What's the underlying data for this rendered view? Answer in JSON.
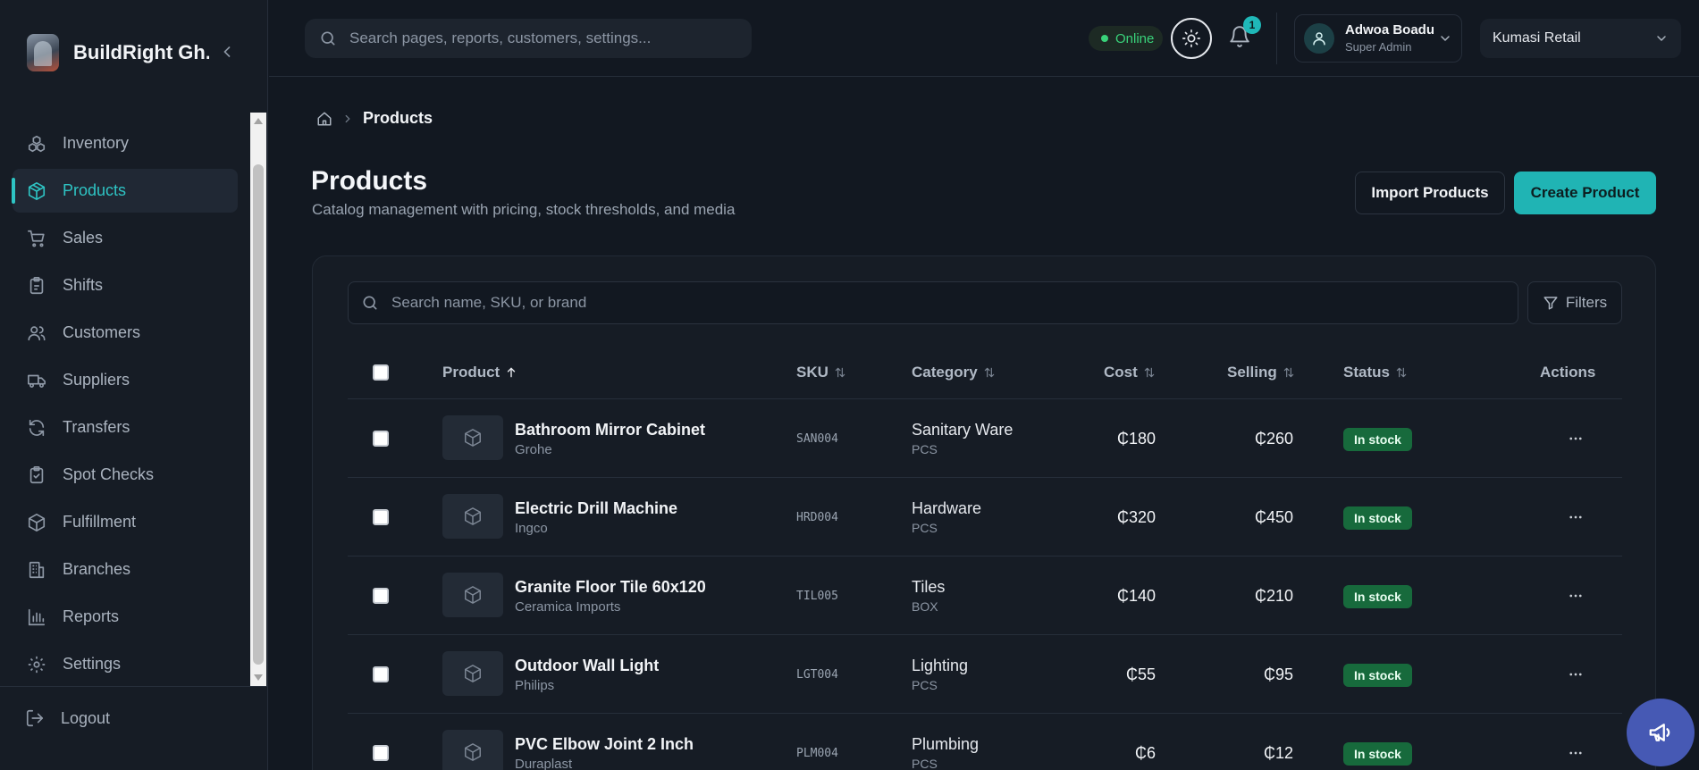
{
  "brand": {
    "name": "BuildRight Gh..."
  },
  "sidebar": {
    "items": [
      {
        "label": "Inventory",
        "icon": "boxes-icon",
        "active": false
      },
      {
        "label": "Products",
        "icon": "package-icon",
        "active": true
      },
      {
        "label": "Sales",
        "icon": "cart-icon",
        "active": false
      },
      {
        "label": "Shifts",
        "icon": "clipboard-icon",
        "active": false
      },
      {
        "label": "Customers",
        "icon": "users-icon",
        "active": false
      },
      {
        "label": "Suppliers",
        "icon": "truck-icon",
        "active": false
      },
      {
        "label": "Transfers",
        "icon": "refresh-icon",
        "active": false
      },
      {
        "label": "Spot Checks",
        "icon": "clipboard-check-icon",
        "active": false
      },
      {
        "label": "Fulfillment",
        "icon": "package-check-icon",
        "active": false
      },
      {
        "label": "Branches",
        "icon": "building-icon",
        "active": false
      },
      {
        "label": "Reports",
        "icon": "bar-chart-icon",
        "active": false
      },
      {
        "label": "Settings",
        "icon": "gear-icon",
        "active": false
      }
    ],
    "logout_label": "Logout"
  },
  "topbar": {
    "search_placeholder": "Search pages, reports, customers, settings...",
    "status_label": "Online",
    "notification_count": "1",
    "user": {
      "name": "Adwoa Boadu",
      "role": "Super Admin"
    },
    "branch": "Kumasi Retail"
  },
  "breadcrumb": {
    "current": "Products"
  },
  "page": {
    "title": "Products",
    "subtitle": "Catalog management with pricing, stock thresholds, and media",
    "import_label": "Import Products",
    "create_label": "Create Product"
  },
  "table": {
    "search_placeholder": "Search name, SKU, or brand",
    "filters_label": "Filters",
    "columns": {
      "product": "Product",
      "sku": "SKU",
      "category": "Category",
      "cost": "Cost",
      "selling": "Selling",
      "status": "Status",
      "actions": "Actions"
    },
    "rows": [
      {
        "name": "Bathroom Mirror Cabinet",
        "brand": "Grohe",
        "sku": "SAN004",
        "category": "Sanitary Ware",
        "unit": "PCS",
        "cost": "₵180",
        "selling": "₵260",
        "status": "In stock"
      },
      {
        "name": "Electric Drill Machine",
        "brand": "Ingco",
        "sku": "HRD004",
        "category": "Hardware",
        "unit": "PCS",
        "cost": "₵320",
        "selling": "₵450",
        "status": "In stock"
      },
      {
        "name": "Granite Floor Tile 60x120",
        "brand": "Ceramica Imports",
        "sku": "TIL005",
        "category": "Tiles",
        "unit": "BOX",
        "cost": "₵140",
        "selling": "₵210",
        "status": "In stock"
      },
      {
        "name": "Outdoor Wall Light",
        "brand": "Philips",
        "sku": "LGT004",
        "category": "Lighting",
        "unit": "PCS",
        "cost": "₵55",
        "selling": "₵95",
        "status": "In stock"
      },
      {
        "name": "PVC Elbow Joint 2 Inch",
        "brand": "Duraplast",
        "sku": "PLM004",
        "category": "Plumbing",
        "unit": "PCS",
        "cost": "₵6",
        "selling": "₵12",
        "status": "In stock"
      }
    ]
  },
  "colors": {
    "accent": "#20b4b4",
    "status_green": "#176a3c",
    "background": "#121821",
    "fab": "#4659b4"
  }
}
